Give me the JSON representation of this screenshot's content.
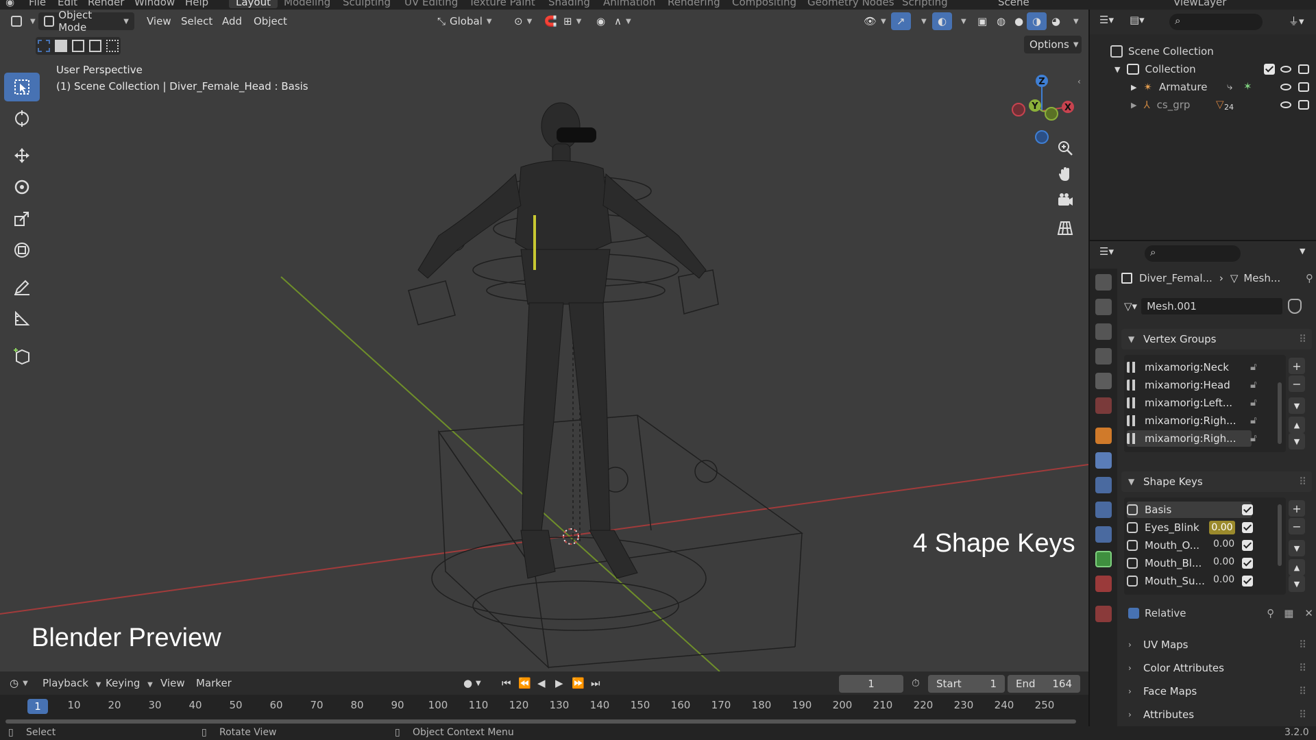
{
  "top_menu": {
    "file": "File",
    "edit": "Edit",
    "render": "Render",
    "window": "Window",
    "help": "Help",
    "workspaces": [
      "Layout",
      "Modeling",
      "Sculpting",
      "UV Editing",
      "Texture Paint",
      "Shading",
      "Animation",
      "Rendering",
      "Compositing",
      "Geometry Nodes",
      "Scripting"
    ],
    "scene": "Scene",
    "view_layer": "ViewLayer"
  },
  "viewport_header": {
    "mode": "Object Mode",
    "view": "View",
    "select": "Select",
    "add": "Add",
    "object": "Object",
    "transform_orientation": "Global",
    "options": "Options"
  },
  "viewport_info": {
    "perspective": "User Perspective",
    "context": "(1) Scene Collection | Diver_Female_Head : Basis"
  },
  "overlay_labels": {
    "shape_keys": "4 Shape Keys",
    "preview": "Blender Preview"
  },
  "gizmo": {
    "x": "X",
    "y": "Y",
    "z": "Z"
  },
  "timeline": {
    "playback": "Playback",
    "keying": "Keying",
    "view": "View",
    "marker": "Marker",
    "current_frame": "1",
    "start_label": "Start",
    "start": "1",
    "end_label": "End",
    "end": "164",
    "ruler_ticks": [
      "1",
      "10",
      "20",
      "30",
      "40",
      "50",
      "60",
      "70",
      "80",
      "90",
      "100",
      "110",
      "120",
      "130",
      "140",
      "150",
      "160",
      "170",
      "180",
      "190",
      "200",
      "210",
      "220",
      "230",
      "240",
      "250"
    ]
  },
  "status_bar": {
    "select": "Select",
    "rotate": "Rotate View",
    "context_menu": "Object Context Menu",
    "version": "3.2.0"
  },
  "outliner": {
    "scene_collection": "Scene Collection",
    "collection": "Collection",
    "armature": "Armature",
    "cs_grp": "cs_grp",
    "cs_grp_count": "24"
  },
  "properties": {
    "breadcrumb_object": "Diver_Femal...",
    "breadcrumb_mesh": "Mesh...",
    "mesh_name": "Mesh.001",
    "vertex_groups_title": "Vertex Groups",
    "vertex_groups": [
      "mixamorig:Neck",
      "mixamorig:Head",
      "mixamorig:Left...",
      "mixamorig:Righ...",
      "mixamorig:Righ..."
    ],
    "shape_keys_title": "Shape Keys",
    "shape_keys": [
      {
        "name": "Basis",
        "value": ""
      },
      {
        "name": "Eyes_Blink",
        "value": "0.00"
      },
      {
        "name": "Mouth_O...",
        "value": "0.00"
      },
      {
        "name": "Mouth_Bl...",
        "value": "0.00"
      },
      {
        "name": "Mouth_Su...",
        "value": "0.00"
      }
    ],
    "relative": "Relative",
    "uv_maps": "UV Maps",
    "color_attributes": "Color Attributes",
    "face_maps": "Face Maps",
    "attributes": "Attributes"
  },
  "colors": {
    "accent": "#4772b3",
    "viewport_bg": "#3d3d3d",
    "x_axis": "#c8434f",
    "y_axis": "#8bb03a",
    "z_axis": "#3f7fd4",
    "highlight_value": "#9b8a2c"
  }
}
